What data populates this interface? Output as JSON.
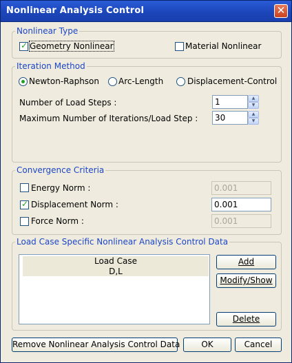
{
  "window": {
    "title": "Nonlinear Analysis Control",
    "close_glyph": "✕"
  },
  "nonlinear_type": {
    "legend": "Nonlinear Type",
    "geometry_label": "Geometry Nonlinear",
    "geometry_checked": true,
    "material_label": "Material Nonlinear",
    "material_checked": false
  },
  "iteration_method": {
    "legend": "Iteration Method",
    "options": [
      "Newton-Raphson",
      "Arc-Length",
      "Displacement-Control"
    ],
    "selected": "Newton-Raphson",
    "load_steps_label": "Number of Load Steps :",
    "load_steps_value": "1",
    "max_iter_label": "Maximum Number of Iterations/Load Step :",
    "max_iter_value": "30"
  },
  "convergence": {
    "legend": "Convergence Criteria",
    "energy_label": "Energy Norm :",
    "energy_checked": false,
    "energy_value": "0.001",
    "displacement_label": "Displacement Norm :",
    "displacement_checked": true,
    "displacement_value": "0.001",
    "force_label": "Force Norm :",
    "force_checked": false,
    "force_value": "0.001"
  },
  "load_case_specific": {
    "legend": "Load Case Specific Nonlinear Analysis Control Data",
    "column_header": "Load Case",
    "rows": [
      "D,L"
    ],
    "add_label": "Add",
    "modify_label": "Modify/Show",
    "delete_label": "Delete"
  },
  "footer": {
    "remove_label": "Remove Nonlinear Analysis Control Data",
    "ok_label": "OK",
    "cancel_label": "Cancel"
  },
  "colors": {
    "title_bar": "#1b45b8",
    "dialog_bg": "#efebde",
    "group_text": "#1c46c8",
    "check": "#21a121"
  },
  "icons": {
    "close": "close-icon",
    "spin_up": "spin-up-icon",
    "spin_down": "spin-down-icon",
    "check": "check-icon"
  }
}
